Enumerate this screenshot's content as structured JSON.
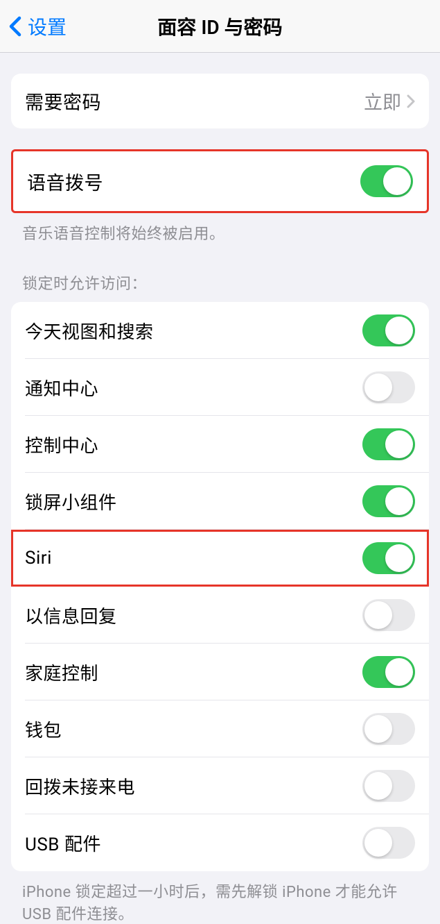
{
  "nav": {
    "back_label": "设置",
    "title": "面容 ID 与密码"
  },
  "require_passcode": {
    "label": "需要密码",
    "value": "立即"
  },
  "voice_dial": {
    "label": "语音拨号",
    "enabled": true,
    "footer": "音乐语音控制将始终被启用。"
  },
  "lock_access": {
    "header": "锁定时允许访问：",
    "items": [
      {
        "label": "今天视图和搜索",
        "enabled": true
      },
      {
        "label": "通知中心",
        "enabled": false
      },
      {
        "label": "控制中心",
        "enabled": true
      },
      {
        "label": "锁屏小组件",
        "enabled": true
      },
      {
        "label": "Siri",
        "enabled": true
      },
      {
        "label": "以信息回复",
        "enabled": false
      },
      {
        "label": "家庭控制",
        "enabled": true
      },
      {
        "label": "钱包",
        "enabled": false
      },
      {
        "label": "回拨未接来电",
        "enabled": false
      },
      {
        "label": "USB 配件",
        "enabled": false
      }
    ],
    "footer": "iPhone 锁定超过一小时后，需先解锁 iPhone 才能允许USB 配件连接。"
  }
}
